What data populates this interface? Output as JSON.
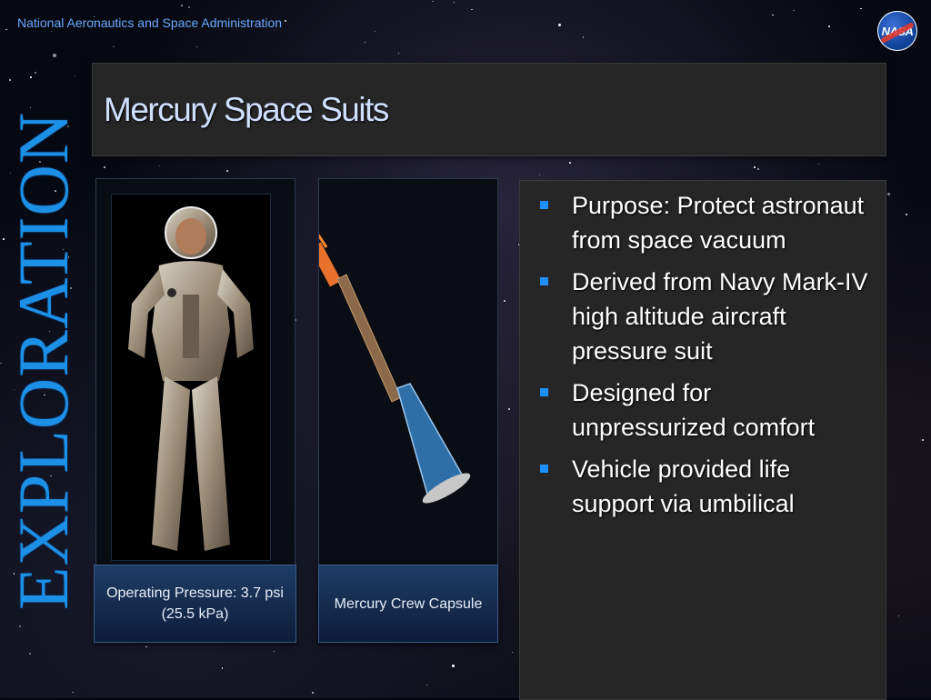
{
  "header": {
    "organization": "National Aeronautics and Space Administration",
    "logo_text": "NASA"
  },
  "vertical_banner": "EXPLORATION",
  "title": "Mercury Space Suits",
  "images": [
    {
      "caption": "Operating Pressure: 3.7 psi (25.5 kPa)"
    },
    {
      "caption": "Mercury Crew Capsule"
    }
  ],
  "bullets": [
    "Purpose:  Protect astronaut from space vacuum",
    "Derived from Navy Mark-IV high altitude aircraft pressure suit",
    "Designed for unpressurized comfort",
    "Vehicle provided life support via umbilical"
  ],
  "colors": {
    "accent_blue": "#1c8fe6",
    "title_text": "#cfe0ff",
    "bullet_marker": "#1f8fff",
    "panel_bg": "#262626"
  }
}
